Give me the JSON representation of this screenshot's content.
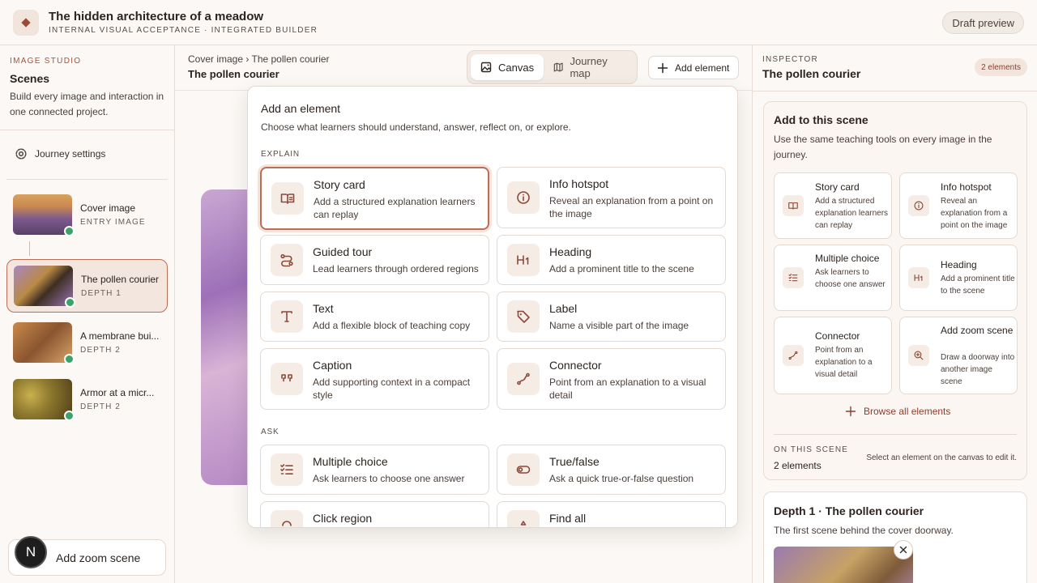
{
  "header": {
    "title": "The hidden architecture of a meadow",
    "subtitle": "INTERNAL VISUAL ACCEPTANCE · INTEGRATED BUILDER",
    "draft_label": "Draft preview"
  },
  "sidebar": {
    "section_label": "IMAGE STUDIO",
    "title": "Scenes",
    "description": "Build every image and interaction in one connected project.",
    "journey_settings": "Journey settings",
    "scenes": [
      {
        "name": "Cover image",
        "depth": "ENTRY IMAGE",
        "status": "ready"
      },
      {
        "name": "The pollen courier",
        "depth": "DEPTH 1",
        "status": "ready"
      },
      {
        "name": "A membrane bui...",
        "depth": "DEPTH 2",
        "status": "ready"
      },
      {
        "name": "Armor at a micr...",
        "depth": "DEPTH 2",
        "status": "ready"
      }
    ],
    "add_zoom": "Add zoom scene",
    "user_initial": "N"
  },
  "center": {
    "breadcrumb_parent": "Cover image",
    "breadcrumb_sep": "›",
    "breadcrumb_current": "The pollen courier",
    "title": "The pollen courier",
    "view_tabs": [
      {
        "label": "Canvas",
        "icon": "image-icon",
        "active": true
      },
      {
        "label": "Journey map",
        "icon": "map-icon",
        "active": false
      }
    ],
    "add_element": "Add element"
  },
  "picker": {
    "title": "Add an element",
    "subtitle": "Choose what learners should understand, answer, reflect on, or explore.",
    "sections": [
      {
        "label": "EXPLAIN"
      },
      {
        "label": "ASK"
      }
    ],
    "items": [
      {
        "name": "Story card",
        "desc": "Add a structured explanation learners can replay",
        "icon": "book-icon"
      },
      {
        "name": "Info hotspot",
        "desc": "Reveal an explanation from a point on the image",
        "icon": "info-icon"
      },
      {
        "name": "Guided tour",
        "desc": "Lead learners through ordered regions",
        "icon": "route-icon"
      },
      {
        "name": "Heading",
        "desc": "Add a prominent title to the scene",
        "icon": "heading-icon"
      },
      {
        "name": "Text",
        "desc": "Add a flexible block of teaching copy",
        "icon": "text-icon"
      },
      {
        "name": "Label",
        "desc": "Name a visible part of the image",
        "icon": "tag-icon"
      },
      {
        "name": "Caption",
        "desc": "Add supporting context in a compact style",
        "icon": "quote-icon"
      },
      {
        "name": "Connector",
        "desc": "Point from an explanation to a visual detail",
        "icon": "connector-icon"
      },
      {
        "name": "Multiple choice",
        "desc": "Ask learners to choose one answer",
        "icon": "list-check-icon"
      },
      {
        "name": "True/false",
        "desc": "Ask a quick true-or-false question",
        "icon": "toggle-icon"
      },
      {
        "name": "Click region",
        "desc": "",
        "icon": "pointer-icon"
      },
      {
        "name": "Find all",
        "desc": "",
        "icon": "search-icon"
      }
    ]
  },
  "inspector": {
    "label": "INSPECTOR",
    "title": "The pollen courier",
    "badge": "2 elements",
    "panel_title": "Add to this scene",
    "panel_desc": "Use the same teaching tools on every image in the journey.",
    "quick": [
      {
        "name": "Story card",
        "desc": "Add a structured explanation learners can replay"
      },
      {
        "name": "Info hotspot",
        "desc": "Reveal an explanation from a point on the image"
      },
      {
        "name": "Multiple choice",
        "desc": "Ask learners to choose one answer"
      },
      {
        "name": "Heading",
        "desc": "Add a prominent title to the scene"
      },
      {
        "name": "Connector",
        "desc": "Point from an explanation to a visual detail"
      },
      {
        "name": "Add zoom scene",
        "desc": "Draw a doorway into another image scene"
      }
    ],
    "browse": "Browse all elements",
    "on_scene_label": "ON THIS SCENE",
    "on_scene_count": "2 elements",
    "on_scene_hint": "Select an element on the canvas to edit it.",
    "depth_title": "Depth 1 · The pollen courier",
    "depth_desc": "The first scene behind the cover doorway."
  }
}
